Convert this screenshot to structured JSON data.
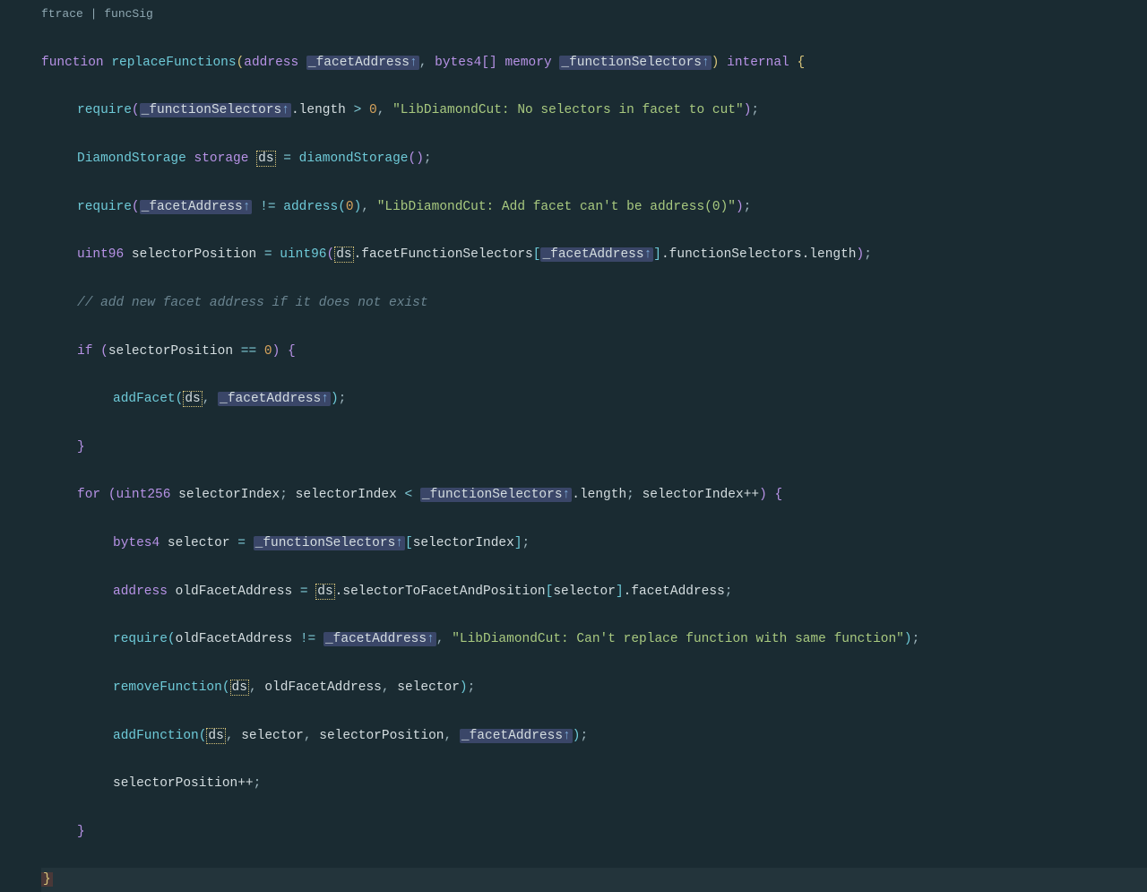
{
  "breadcrumb": "ftrace | funcSig",
  "code": {
    "l1": {
      "kw_function": "function",
      "name": "replaceFunctions",
      "ty_address": "address",
      "param1": "_facetAddress",
      "ty_bytes4arr": "bytes4[]",
      "kw_memory": "memory",
      "param2": "_functionSelectors",
      "kw_internal": "internal"
    },
    "l2": {
      "fn_require": "require",
      "arg": "_functionSelectors",
      "prop": ".length",
      "op": " > ",
      "zero": "0",
      "str": "\"LibDiamondCut: No selectors in facet to cut\""
    },
    "l3": {
      "ty": "DiamondStorage",
      "kw_storage": "storage",
      "ds": "ds",
      "eq": " = ",
      "fn": "diamondStorage"
    },
    "l4": {
      "fn_require": "require",
      "arg": "_facetAddress",
      "op": " != ",
      "fn_address": "address",
      "zero": "0",
      "str": "\"LibDiamondCut: Add facet can't be address(0)\""
    },
    "l5": {
      "ty": "uint96",
      "var": "selectorPosition",
      "eq": " = ",
      "fn_cast": "uint96",
      "ds": "ds",
      "p1": ".facetFunctionSelectors",
      "arg": "_facetAddress",
      "p2": ".functionSelectors.length"
    },
    "l6": {
      "cmt": "// add new facet address if it does not exist"
    },
    "l7": {
      "kw_if": "if",
      "cond_var": "selectorPosition",
      "op": " == ",
      "zero": "0"
    },
    "l8": {
      "fn": "addFacet",
      "ds": "ds",
      "arg": "_facetAddress"
    },
    "l10": {
      "kw_for": "for",
      "ty": "uint256",
      "var": "selectorIndex",
      "cond_l": "selectorIndex",
      "op": " < ",
      "arg": "_functionSelectors",
      "prop": ".length",
      "inc": "selectorIndex++"
    },
    "l11": {
      "ty": "bytes4",
      "var": "selector",
      "eq": " = ",
      "arg": "_functionSelectors",
      "idx": "selectorIndex"
    },
    "l12": {
      "ty": "address",
      "var": "oldFacetAddress",
      "eq": " = ",
      "ds": "ds",
      "p1": ".selectorToFacetAndPosition",
      "idx": "selector",
      "p2": ".facetAddress"
    },
    "l13": {
      "fn_require": "require",
      "arg1": "oldFacetAddress",
      "op": " != ",
      "arg2": "_facetAddress",
      "str": "\"LibDiamondCut: Can't replace function with same function\""
    },
    "l14": {
      "fn": "removeFunction",
      "ds": "ds",
      "a2": "oldFacetAddress",
      "a3": "selector"
    },
    "l15": {
      "fn": "addFunction",
      "ds": "ds",
      "a2": "selector",
      "a3": "selectorPosition",
      "a4": "_facetAddress"
    },
    "l16": {
      "stmt": "selectorPosition++"
    }
  }
}
